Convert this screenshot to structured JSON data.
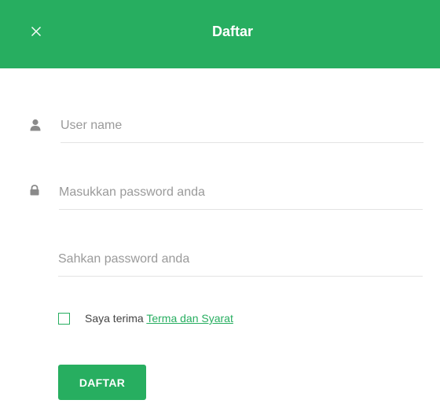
{
  "header": {
    "title": "Daftar",
    "close_icon": "close-icon"
  },
  "form": {
    "username": {
      "placeholder": "User name",
      "value": "",
      "icon": "user-icon"
    },
    "password": {
      "placeholder": "Masukkan password anda",
      "value": "",
      "icon": "lock-icon"
    },
    "confirm_password": {
      "placeholder": "Sahkan password anda",
      "value": ""
    },
    "terms": {
      "checked": false,
      "prefix": "Saya terima",
      "link_label": "Terma dan Syarat"
    },
    "submit_label": "DAFTAR"
  },
  "colors": {
    "accent": "#27ae60",
    "header_text": "#ffffff",
    "placeholder": "#9a9a9a",
    "divider": "#e3e3e3"
  }
}
